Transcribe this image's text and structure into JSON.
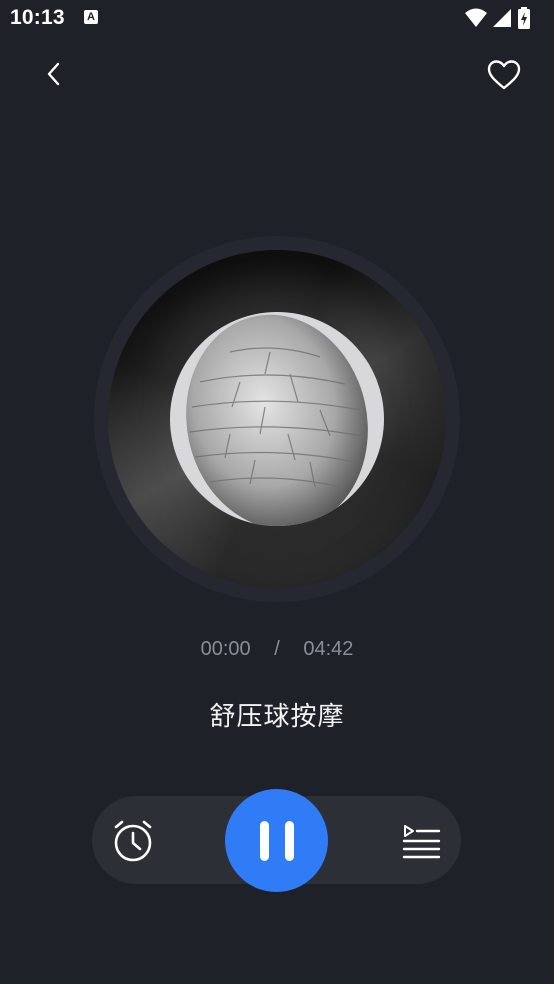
{
  "status_bar": {
    "time": "10:13",
    "notification_icon_letter": "A",
    "icons": [
      "wifi-icon",
      "signal-icon",
      "battery-charging-icon"
    ]
  },
  "header": {
    "back_icon": "chevron-left-icon",
    "favorite_icon": "heart-outline-icon"
  },
  "player": {
    "current_time": "00:00",
    "separator": "/",
    "duration": "04:42",
    "title": "舒压球按摩",
    "progress": 0.0,
    "state": "playing"
  },
  "controls": {
    "timer_icon": "alarm-clock-icon",
    "pause_icon": "pause-icon",
    "playlist_icon": "playlist-icon"
  },
  "colors": {
    "background": "#1f2128",
    "accent": "#2f7cf6",
    "control_bar": "#2c2f36",
    "muted_text": "#8a8d95"
  }
}
